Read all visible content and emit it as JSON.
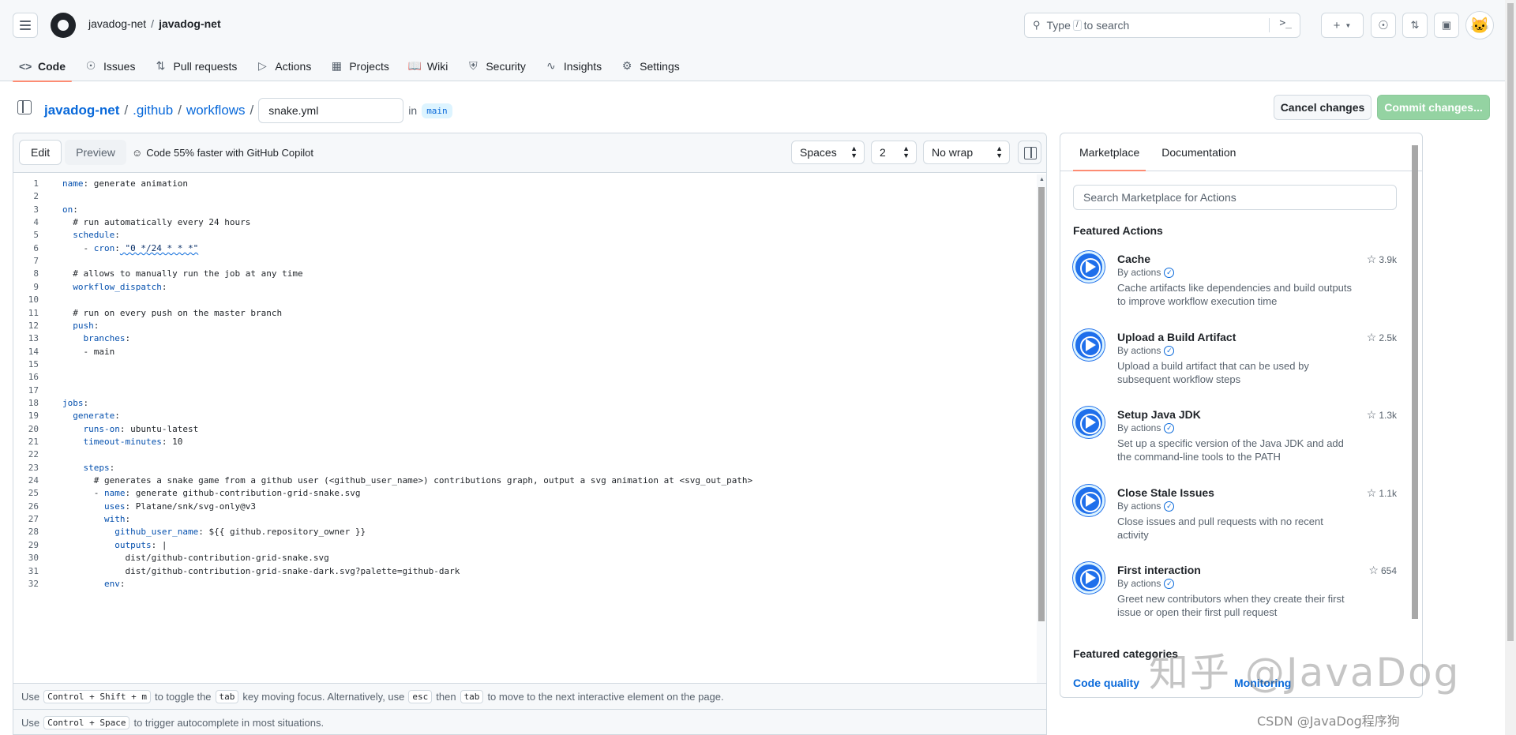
{
  "repo": {
    "owner": "javadog-net",
    "name": "javadog-net"
  },
  "search": {
    "placeholder_pre": "Type",
    "kbd": "/",
    "placeholder_post": "to search"
  },
  "header_icons": [
    "terminal-icon",
    "plus-icon",
    "issue-icon",
    "pull-request-icon",
    "inbox-icon",
    "avatar-cat"
  ],
  "nav_tabs": [
    {
      "label": "Code",
      "icon": "code-icon",
      "active": true
    },
    {
      "label": "Issues",
      "icon": "issue-icon"
    },
    {
      "label": "Pull requests",
      "icon": "pull-request-icon"
    },
    {
      "label": "Actions",
      "icon": "play-icon"
    },
    {
      "label": "Projects",
      "icon": "table-icon"
    },
    {
      "label": "Wiki",
      "icon": "book-icon"
    },
    {
      "label": "Security",
      "icon": "shield-icon"
    },
    {
      "label": "Insights",
      "icon": "graph-icon"
    },
    {
      "label": "Settings",
      "icon": "gear-icon"
    }
  ],
  "path": {
    "root": "javadog-net",
    "dir1": ".github",
    "dir2": "workflows",
    "filename": "snake.yml",
    "in_label": "in",
    "branch": "main"
  },
  "buttons": {
    "cancel": "Cancel changes",
    "commit": "Commit changes..."
  },
  "editor": {
    "edit_tab": "Edit",
    "preview_tab": "Preview",
    "copilot": "Code 55% faster with GitHub Copilot",
    "indent_mode": "Spaces",
    "indent_size": "2",
    "wrap_mode": "No wrap"
  },
  "code_lines": [
    "name: generate animation",
    "",
    "on:",
    "  # run automatically every 24 hours",
    "  schedule:",
    "    - cron: \"0 */24 * * *\"",
    "",
    "  # allows to manually run the job at any time",
    "  workflow_dispatch:",
    "",
    "  # run on every push on the master branch",
    "  push:",
    "    branches:",
    "    - main",
    "",
    "",
    "",
    "jobs:",
    "  generate:",
    "    runs-on: ubuntu-latest",
    "    timeout-minutes: 10",
    "",
    "    steps:",
    "      # generates a snake game from a github user (<github_user_name>) contributions graph, output a svg animation at <svg_out_path>",
    "      - name: generate github-contribution-grid-snake.svg",
    "        uses: Platane/snk/svg-only@v3",
    "        with:",
    "          github_user_name: ${{ github.repository_owner }}",
    "          outputs: |",
    "            dist/github-contribution-grid-snake.svg",
    "            dist/github-contribution-grid-snake-dark.svg?palette=github-dark",
    "        env:"
  ],
  "hints": {
    "line1": {
      "pre": "Use",
      "k1": "Control + Shift + m",
      "mid1": "to toggle the",
      "k2": "tab",
      "mid2": "key moving focus. Alternatively, use",
      "k3": "esc",
      "mid3": "then",
      "k4": "tab",
      "post": "to move to the next interactive element on the page."
    },
    "line2": {
      "pre": "Use",
      "k1": "Control + Space",
      "post": "to trigger autocomplete in most situations."
    }
  },
  "sidebar": {
    "tabs": [
      "Marketplace",
      "Documentation"
    ],
    "search_placeholder": "Search Marketplace for Actions",
    "featured_actions_title": "Featured Actions",
    "actions": [
      {
        "name": "Cache",
        "by": "By actions",
        "desc": "Cache artifacts like dependencies and build outputs to improve workflow execution time",
        "stars": "3.9k"
      },
      {
        "name": "Upload a Build Artifact",
        "by": "By actions",
        "desc": "Upload a build artifact that can be used by subsequent workflow steps",
        "stars": "2.5k"
      },
      {
        "name": "Setup Java JDK",
        "by": "By actions",
        "desc": "Set up a specific version of the Java JDK and add the command-line tools to the PATH",
        "stars": "1.3k"
      },
      {
        "name": "Close Stale Issues",
        "by": "By actions",
        "desc": "Close issues and pull requests with no recent activity",
        "stars": "1.1k"
      },
      {
        "name": "First interaction",
        "by": "By actions",
        "desc": "Greet new contributors when they create their first issue or open their first pull request",
        "stars": "654"
      }
    ],
    "featured_categories_title": "Featured categories",
    "categories": [
      "Code quality",
      "Monitoring"
    ]
  },
  "watermark": {
    "main": "知乎 @JavaDog",
    "footer": "CSDN @JavaDog程序狗"
  }
}
